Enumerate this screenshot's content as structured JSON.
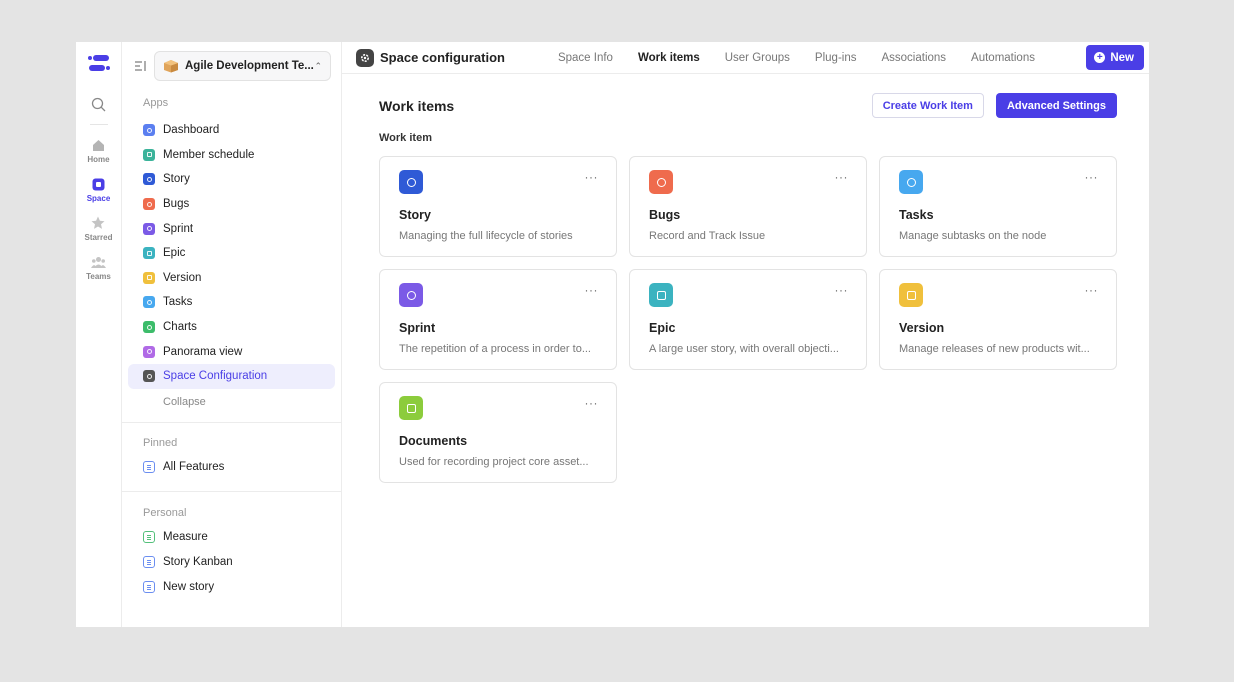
{
  "rail": {
    "items": [
      {
        "label": "Home",
        "icon": "home-icon"
      },
      {
        "label": "Space",
        "icon": "space-icon",
        "active": true
      },
      {
        "label": "Starred",
        "icon": "star-icon"
      },
      {
        "label": "Teams",
        "icon": "teams-icon"
      }
    ]
  },
  "sidebar": {
    "space_name": "Agile Development Te...",
    "apps_label": "Apps",
    "apps": [
      {
        "label": "Dashboard",
        "color": "#5b7ff0"
      },
      {
        "label": "Member schedule",
        "color": "#3bb39a"
      },
      {
        "label": "Story",
        "color": "#2f5ad6"
      },
      {
        "label": "Bugs",
        "color": "#ef6b4d"
      },
      {
        "label": "Sprint",
        "color": "#7b5ae6"
      },
      {
        "label": "Epic",
        "color": "#3bb3c0"
      },
      {
        "label": "Version",
        "color": "#f0c03c"
      },
      {
        "label": "Tasks",
        "color": "#47a8ef"
      },
      {
        "label": "Charts",
        "color": "#3cbc6a"
      },
      {
        "label": "Panorama view",
        "color": "#b06ae6"
      },
      {
        "label": "Space Configuration",
        "color": "#555555",
        "active": true
      }
    ],
    "collapse_label": "Collapse",
    "pinned_label": "Pinned",
    "pinned": [
      {
        "label": "All Features"
      }
    ],
    "personal_label": "Personal",
    "personal": [
      {
        "label": "Measure",
        "color": "green"
      },
      {
        "label": "Story Kanban",
        "color": "blue"
      },
      {
        "label": "New story",
        "color": "blue"
      }
    ]
  },
  "topbar": {
    "title": "Space configuration",
    "tabs": [
      "Space Info",
      "Work items",
      "User Groups",
      "Plug-ins",
      "Associations",
      "Automations"
    ],
    "active_tab": "Work items",
    "new_label": "New"
  },
  "content": {
    "title": "Work items",
    "create_label": "Create Work Item",
    "advanced_label": "Advanced Settings",
    "section_label": "Work item",
    "cards": [
      {
        "name": "Story",
        "desc": "Managing the full lifecycle of stories",
        "color": "#2f5ad6",
        "icon": "story-icon"
      },
      {
        "name": "Bugs",
        "desc": "Record and Track Issue",
        "color": "#ef6b4d",
        "icon": "bug-icon"
      },
      {
        "name": "Tasks",
        "desc": "Manage subtasks on the node",
        "color": "#47a8ef",
        "icon": "task-icon"
      },
      {
        "name": "Sprint",
        "desc": "The repetition of a process in order to...",
        "color": "#7b5ae6",
        "icon": "sprint-icon"
      },
      {
        "name": "Epic",
        "desc": "A large user story, with overall objecti...",
        "color": "#3bb3c0",
        "icon": "epic-icon"
      },
      {
        "name": "Version",
        "desc": "Manage releases of new products wit...",
        "color": "#f0c03c",
        "icon": "version-icon"
      },
      {
        "name": "Documents",
        "desc": "Used for recording project core asset...",
        "color": "#8ccc3c",
        "icon": "documents-icon"
      }
    ],
    "more_label": "···"
  }
}
